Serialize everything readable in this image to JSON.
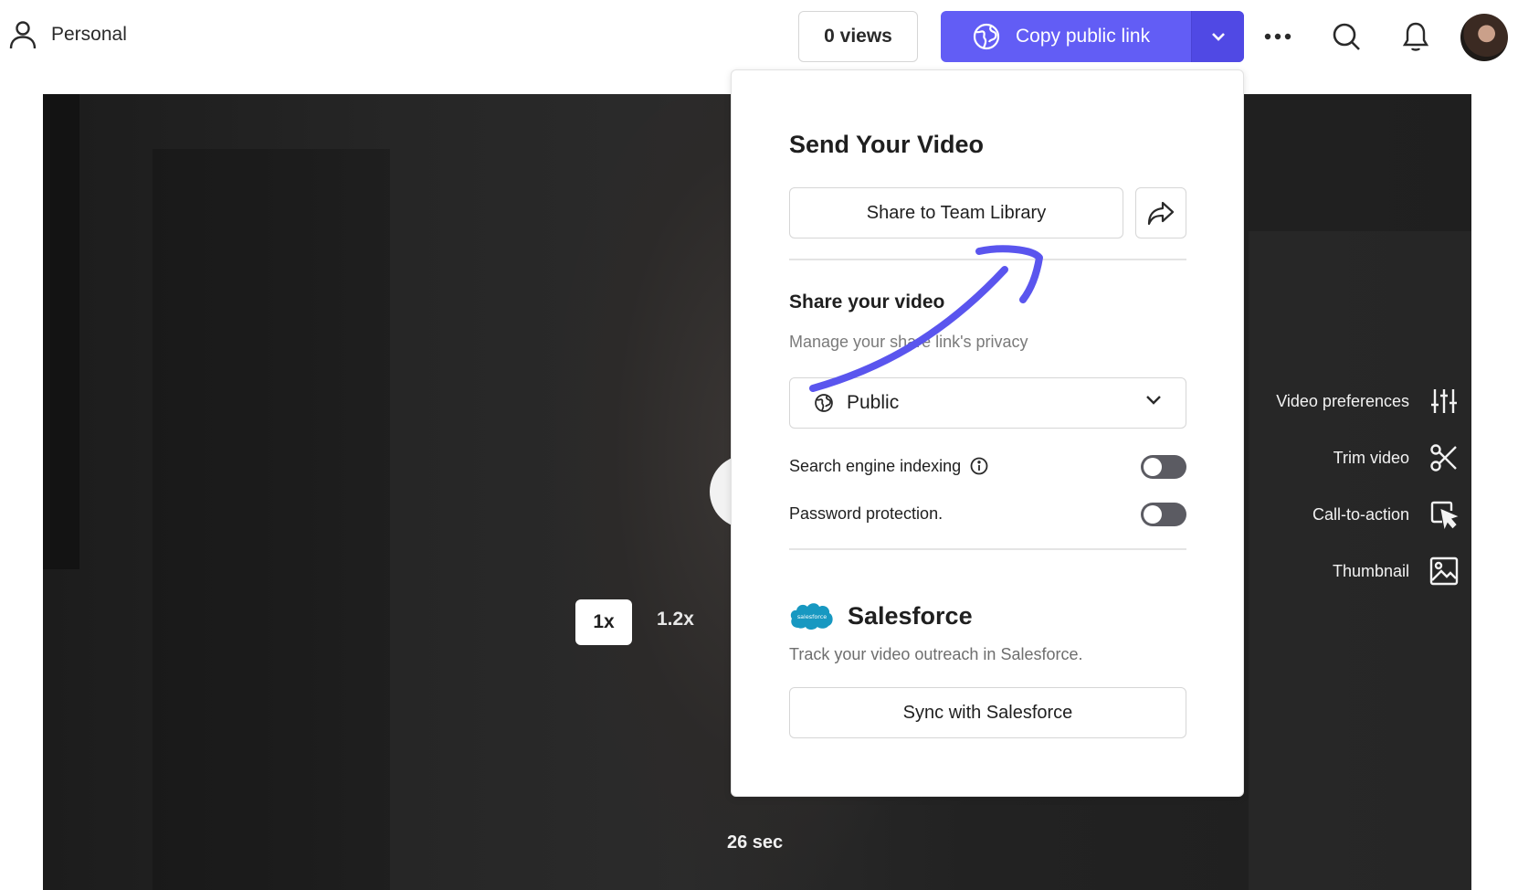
{
  "header": {
    "workspace_label": "Personal",
    "views_label": "0 views",
    "copy_link_label": "Copy public link"
  },
  "video": {
    "speed_active": "1x",
    "speed_alt": "1.2x",
    "duration": "26 sec",
    "tools": [
      {
        "label": "Video preferences",
        "icon": "sliders-icon"
      },
      {
        "label": "Trim video",
        "icon": "scissors-icon"
      },
      {
        "label": "Call-to-action",
        "icon": "cursor-click-icon"
      },
      {
        "label": "Thumbnail",
        "icon": "image-icon"
      }
    ]
  },
  "share_panel": {
    "title": "Send Your Video",
    "share_team_label": "Share to Team Library",
    "section_title": "Share your video",
    "section_subtitle": "Manage your share link's privacy",
    "privacy_value": "Public",
    "search_indexing_label": "Search engine indexing",
    "search_indexing_on": false,
    "password_label": "Password protection.",
    "password_on": false,
    "integration_logo_text": "salesforce",
    "integration_name": "Salesforce",
    "integration_desc": "Track your video outreach in Salesforce.",
    "sync_label": "Sync with Salesforce"
  },
  "colors": {
    "accent": "#625df5",
    "annotation_arrow": "#5a55ee",
    "salesforce_blue": "#1798c1"
  }
}
